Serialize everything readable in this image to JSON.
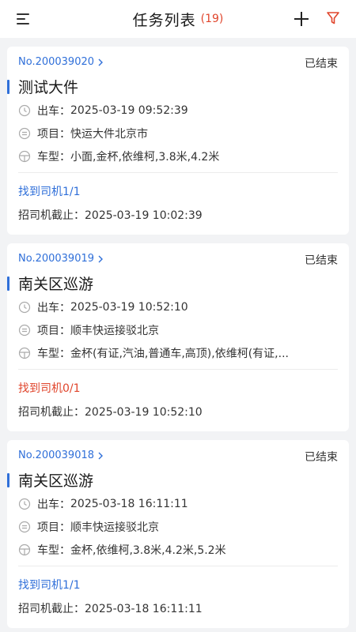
{
  "header": {
    "title": "任务列表",
    "count": "(19)",
    "icons": {
      "menu": "menu-lines-icon",
      "add": "plus-icon",
      "filter": "filter-funnel-icon"
    },
    "accent": "#e0452c"
  },
  "labels": {
    "depart": "出车：",
    "project": "项目：",
    "vehicle": "车型：",
    "deadline": "招司机截止："
  },
  "colors": {
    "link": "#2f6fd9",
    "warn": "#e0452c",
    "background": "#f2f3f5"
  },
  "tasks": [
    {
      "order_no": "No.200039020",
      "status": "已结束",
      "name": "测试大件",
      "depart_time": "2025-03-19 09:52:39",
      "project": "快运大件北京市",
      "vehicle": "小面,金杯,依维柯,3.8米,4.2米",
      "drivers": "找到司机1/1",
      "deadline": "2025-03-19 10:02:39"
    },
    {
      "order_no": "No.200039019",
      "status": "已结束",
      "name": "南关区巡游",
      "depart_time": "2025-03-19 10:52:10",
      "project": "顺丰快运接驳北京",
      "vehicle": "金杯(有证,汽油,普通车,高顶),依维柯(有证,...",
      "drivers": "找到司机0/1",
      "deadline": "2025-03-19 10:52:10"
    },
    {
      "order_no": "No.200039018",
      "status": "已结束",
      "name": "南关区巡游",
      "depart_time": "2025-03-18 16:11:11",
      "project": "顺丰快运接驳北京",
      "vehicle": "金杯,依维柯,3.8米,4.2米,5.2米",
      "drivers": "找到司机1/1",
      "deadline": "2025-03-18 16:11:11"
    }
  ]
}
